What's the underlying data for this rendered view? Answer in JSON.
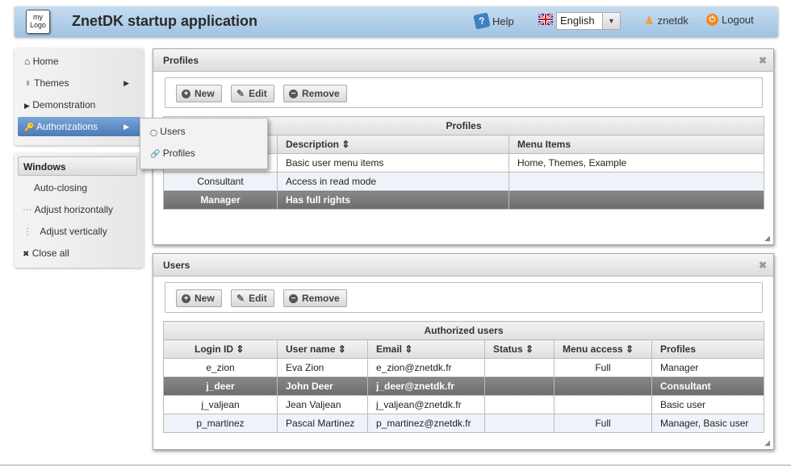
{
  "header": {
    "logo_text_1": "my",
    "logo_text_2": "Logo",
    "title": "ZnetDK startup application",
    "help": "Help",
    "language": "English",
    "user": "znetdk",
    "logout": "Logout"
  },
  "nav": {
    "items": [
      {
        "icon": "⌂",
        "label": "Home"
      },
      {
        "icon": "♀",
        "label": "Themes"
      },
      {
        "icon": "▶",
        "label": "Demonstration"
      },
      {
        "icon": "🔑",
        "label": "Authorizations"
      }
    ],
    "submenu": [
      {
        "icon": "◯",
        "label": "Users"
      },
      {
        "icon": "🔗",
        "label": "Profiles"
      }
    ]
  },
  "windows": {
    "title": "Windows",
    "items": [
      {
        "icon": "",
        "label": "Auto-closing"
      },
      {
        "icon": "⋯",
        "label": "Adjust horizontally"
      },
      {
        "icon": "⋮",
        "label": "Adjust vertically"
      },
      {
        "icon": "✖",
        "label": "Close all"
      }
    ]
  },
  "profiles_panel": {
    "title": "Profiles",
    "buttons": {
      "new": "New",
      "edit": "Edit",
      "remove": "Remove"
    },
    "caption": "Profiles",
    "columns": [
      "Description ⇕",
      "Menu Items"
    ],
    "rows": [
      {
        "name": "",
        "desc": "Basic user menu items",
        "items": "Home, Themes, Example"
      },
      {
        "name": "Consultant",
        "desc": "Access in read mode",
        "items": ""
      },
      {
        "name": "Manager",
        "desc": "Has full rights",
        "items": ""
      }
    ]
  },
  "users_panel": {
    "title": "Users",
    "buttons": {
      "new": "New",
      "edit": "Edit",
      "remove": "Remove"
    },
    "caption": "Authorized users",
    "columns": [
      "Login ID ⇕",
      "User name ⇕",
      "Email ⇕",
      "Status ⇕",
      "Menu access ⇕",
      "Profiles"
    ],
    "rows": [
      {
        "login": "e_zion",
        "name": "Eva Zion",
        "email": "e_zion@znetdk.fr",
        "status": "",
        "access": "Full",
        "profiles": "Manager"
      },
      {
        "login": "j_deer",
        "name": "John Deer",
        "email": "j_deer@znetdk.fr",
        "status": "",
        "access": "",
        "profiles": "Consultant"
      },
      {
        "login": "j_valjean",
        "name": "Jean Valjean",
        "email": "j_valjean@znetdk.fr",
        "status": "",
        "access": "",
        "profiles": "Basic user"
      },
      {
        "login": "p_martinez",
        "name": "Pascal Martinez",
        "email": "p_martinez@znetdk.fr",
        "status": "",
        "access": "Full",
        "profiles": "Manager, Basic user"
      }
    ]
  }
}
